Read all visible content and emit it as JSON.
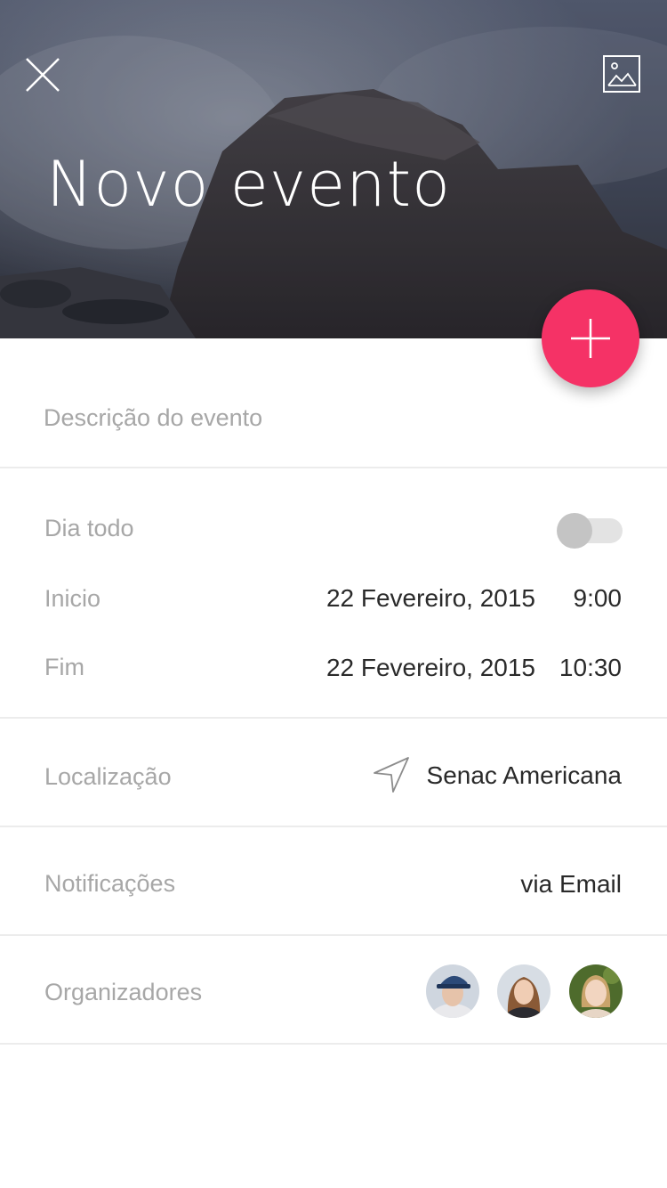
{
  "header": {
    "title": "Novo evento",
    "close_icon": "close-icon",
    "image_icon": "image-icon"
  },
  "fab": {
    "icon": "plus-icon",
    "color": "#f53266"
  },
  "form": {
    "description_placeholder": "Descrição do evento",
    "all_day": {
      "label": "Dia todo",
      "enabled": false
    },
    "start": {
      "label": "Inicio",
      "date": "22 Fevereiro, 2015",
      "time": "9:00"
    },
    "end": {
      "label": "Fim",
      "date": "22 Fevereiro, 2015",
      "time": "10:30"
    },
    "location": {
      "label": "Localização",
      "value": "Senac Americana",
      "icon": "navigation-arrow-icon"
    },
    "notifications": {
      "label": "Notificações",
      "value": "via Email"
    },
    "organizers": {
      "label": "Organizadores",
      "count": 3
    }
  }
}
